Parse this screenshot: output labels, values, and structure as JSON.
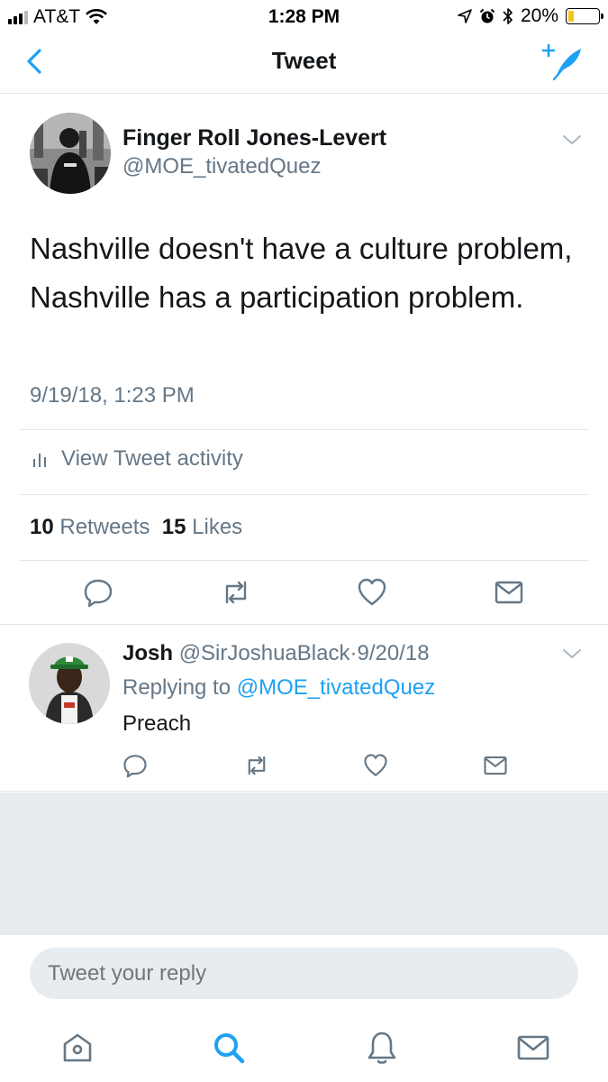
{
  "status_bar": {
    "carrier": "AT&T",
    "time": "1:28 PM",
    "battery_percent": "20%",
    "battery_level": 0.2
  },
  "nav": {
    "title": "Tweet",
    "back_icon": "chevron-left-icon",
    "compose_icon": "compose-tweet-icon"
  },
  "tweet": {
    "author_name": "Finger Roll Jones-Levert",
    "author_handle": "@MOE_tivatedQuez",
    "text": "Nashville doesn't have a culture problem, Nashville has a participation problem.",
    "timestamp": "9/19/18, 1:23 PM",
    "activity_label": "View Tweet activity",
    "retweets_count": "10",
    "retweets_label": "Retweets",
    "likes_count": "15",
    "likes_label": "Likes"
  },
  "reply": {
    "author_name": "Josh",
    "author_handle": "@SirJoshuaBlack",
    "separator": "·",
    "date": "9/20/18",
    "replying_prefix": "Replying to",
    "replying_to": "@MOE_tivatedQuez",
    "text": "Preach"
  },
  "composer": {
    "placeholder": "Tweet your reply"
  },
  "tabs": [
    "home-icon",
    "search-icon",
    "notifications-icon",
    "messages-icon"
  ],
  "colors": {
    "accent": "#1da1f2",
    "secondary_text": "#657786",
    "divider": "#e1e8ed",
    "background_gray": "#e6ecf0"
  }
}
